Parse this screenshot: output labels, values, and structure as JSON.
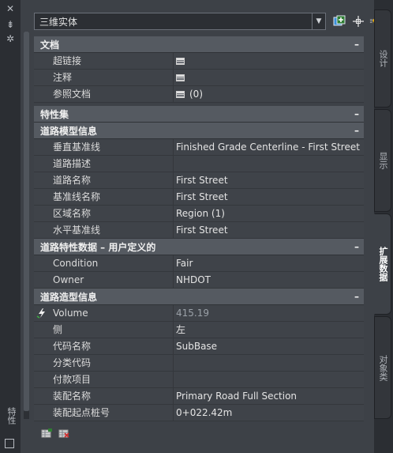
{
  "left_strip": {
    "buttons": [
      "✕",
      "⇟",
      "✲"
    ],
    "title": "特性"
  },
  "selector": {
    "value": "三维实体",
    "arrow": "▼"
  },
  "toolbar": [
    "select-objects-plus-icon",
    "crosshair-select-icon",
    "quick-select-icon"
  ],
  "groups": [
    {
      "title": "文档",
      "toggle": "–",
      "rows": [
        {
          "name": "超链接",
          "value": "",
          "icon": "table-icon"
        },
        {
          "name": "注释",
          "value": "",
          "icon": "table-icon"
        },
        {
          "name": "参照文档",
          "value": "(0)",
          "icon": "table-icon"
        }
      ]
    },
    {
      "title": "特性集",
      "toggle": "–",
      "rows": []
    },
    {
      "title": "道路模型信息",
      "toggle": "–",
      "rows": [
        {
          "name": "垂直基准线",
          "value": "Finished Grade Centerline - First Street"
        },
        {
          "name": "道路描述",
          "value": ""
        },
        {
          "name": "道路名称",
          "value": "First Street"
        },
        {
          "name": "基准线名称",
          "value": "First Street"
        },
        {
          "name": "区域名称",
          "value": "Region (1)"
        },
        {
          "name": "水平基准线",
          "value": "First Street"
        }
      ]
    },
    {
      "title": "道路特性数据 – 用户定义的",
      "toggle": "–",
      "rows": [
        {
          "name": "Condition",
          "value": "Fair"
        },
        {
          "name": "Owner",
          "value": "NHDOT"
        }
      ]
    },
    {
      "title": "道路造型信息",
      "toggle": "–",
      "rows": [
        {
          "name": "Volume",
          "value": "415.19",
          "readonly": true,
          "gutter_icon": "lightning-bolt-icon"
        },
        {
          "name": "侧",
          "value": "左"
        },
        {
          "name": "代码名称",
          "value": "SubBase"
        },
        {
          "name": "分类代码",
          "value": ""
        },
        {
          "name": "付款项目",
          "value": ""
        },
        {
          "name": "装配名称",
          "value": "Primary Road Full Section"
        },
        {
          "name": "装配起点桩号",
          "value": "0+022.42m"
        }
      ]
    }
  ],
  "tabs": [
    {
      "label": "设计",
      "active": false
    },
    {
      "label": "显示",
      "active": false
    },
    {
      "label": "扩展数据",
      "active": true
    },
    {
      "label": "对象类",
      "active": false
    }
  ],
  "bottom_icons": [
    "add-property-set-icon",
    "remove-property-set-icon"
  ]
}
